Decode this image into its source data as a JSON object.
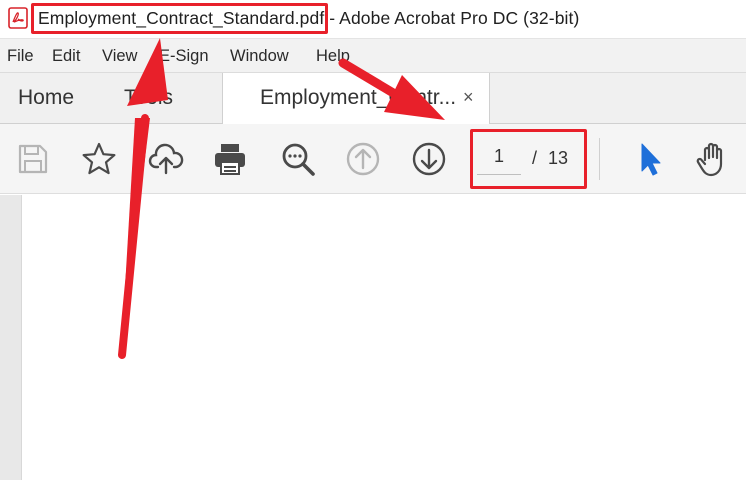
{
  "window": {
    "filename": "Employment_Contract_Standard.pdf",
    "title_suffix": " - Adobe Acrobat Pro DC (32-bit)",
    "app_icon": "pdf-icon"
  },
  "menu": {
    "items": [
      "File",
      "Edit",
      "View",
      "E-Sign",
      "Window",
      "Help"
    ]
  },
  "tabs": {
    "home": "Home",
    "tools": "Tools",
    "document": "Employment_Contr...",
    "close_glyph": "×"
  },
  "toolbar": {
    "icons": [
      "save-icon",
      "bookmark-star-icon",
      "upload-cloud-icon",
      "print-icon",
      "zoom-search-icon",
      "page-up-icon",
      "page-down-icon",
      "select-cursor-icon",
      "hand-tool-icon"
    ],
    "current_page": "1",
    "separator": "/",
    "total_pages": "13"
  },
  "colors": {
    "annotation_red": "#e8202a",
    "cursor_blue": "#1e6fd9",
    "icon_gray": "#4a4a4a",
    "icon_disabled": "#b5b5b5"
  }
}
